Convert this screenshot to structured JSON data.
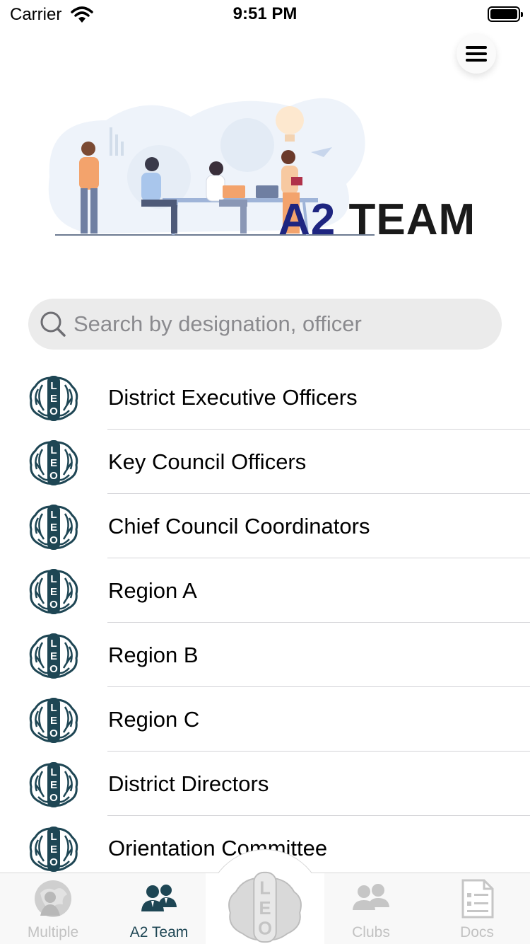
{
  "status_bar": {
    "carrier": "Carrier",
    "time": "9:51 PM"
  },
  "hero": {
    "title_part1": "A2",
    "title_part2": "TEAM"
  },
  "search": {
    "placeholder": "Search by designation, officer"
  },
  "list": {
    "logo_text": "LEO",
    "items": [
      {
        "label": "District Executive Officers"
      },
      {
        "label": "Key Council Officers"
      },
      {
        "label": "Chief Council Coordinators"
      },
      {
        "label": "Region A"
      },
      {
        "label": "Region B"
      },
      {
        "label": "Region C"
      },
      {
        "label": "District Directors"
      },
      {
        "label": "Orientation Committee"
      }
    ]
  },
  "tab_bar": {
    "tabs": [
      {
        "label": "Multiple",
        "icon": "globe-person-icon",
        "active": false
      },
      {
        "label": "A2 Team",
        "icon": "team-icon",
        "active": true
      },
      {
        "label": "",
        "icon": "leo-logo-icon",
        "active": false
      },
      {
        "label": "Clubs",
        "icon": "clubs-icon",
        "active": false
      },
      {
        "label": "Docs",
        "icon": "document-icon",
        "active": false
      }
    ]
  },
  "colors": {
    "accent": "#1e4654",
    "title_blue": "#1e2580",
    "inactive_tab": "#c2c2c2",
    "search_bg": "#ebebeb"
  }
}
